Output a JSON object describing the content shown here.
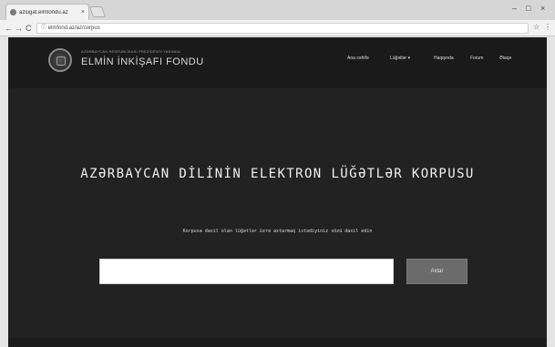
{
  "browser": {
    "tab_title": "azlugat.elmfondu.az",
    "tab_close": "×",
    "address": "ⓘ elmfond.az/az/corpus",
    "controls": {
      "minimize": "–",
      "maximize": "□",
      "close": "×"
    },
    "nav": {
      "back": "←",
      "forward": "→",
      "reload": "C"
    },
    "omni_icons": {
      "star": "☆",
      "menu": "⋮"
    }
  },
  "site": {
    "logo_small": "AZƏRBAYCAN RESPUBLİKASI PREZİDENTİ YANINDA",
    "logo_title": "ELMİN İNKİŞAFI FONDU",
    "menu": [
      "Ana səhifə",
      "Lüğətlər ▾",
      "Haqqında",
      "Forum",
      "Əlaqə"
    ]
  },
  "hero": {
    "title": "AZƏRBAYCAN DİLİNİN ELEKTRON LÜĞƏTLƏR KORPUSU",
    "subtitle": "Korpusa daxil olan lüğətlər üzrə axtarmaq istədiyiniz sözü daxil edin",
    "input_value": "",
    "button_label": "Axtar"
  },
  "colors": {
    "page_bg": "#222222",
    "navbar_bg": "#1a1a1a",
    "button_bg": "#6b6b6b"
  }
}
